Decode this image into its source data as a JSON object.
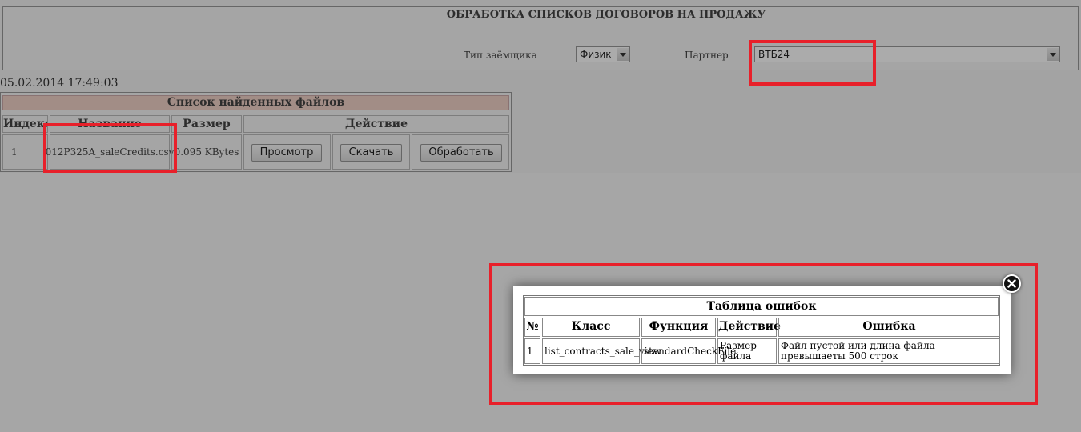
{
  "header": {
    "title": "ОБРАБОТКА СПИСКОВ ДОГОВОРОВ НА ПРОДАЖУ",
    "borrower_type_label": "Тип заёмщика",
    "borrower_type_value": "Физик",
    "partner_label": "Партнер",
    "partner_value": "ВТБ24"
  },
  "timestamp": "05.02.2014 17:49:03",
  "files": {
    "caption": "Список найденных файлов",
    "columns": [
      "Индекс",
      "Название",
      "Размер",
      "Действие"
    ],
    "rows": [
      {
        "index": "1",
        "name": "012P325A_saleCredits.csv",
        "size": "0.095 KBytes",
        "view_label": "Просмотр",
        "download_label": "Скачать",
        "process_label": "Обработать"
      }
    ]
  },
  "error_modal": {
    "title": "Таблица ошибок",
    "columns": [
      "№",
      "Класс",
      "Функция",
      "Действие",
      "Ошибка"
    ],
    "rows": [
      {
        "num": "1",
        "class": "list_contracts_sale_view",
        "function": "standardCheckFile",
        "action": "Размер файла",
        "error": "Файл пустой или длина файла превышаеты 500 строк"
      }
    ]
  },
  "colors": {
    "highlight": "#e8202a",
    "caption_bg": "#f2d2c8",
    "overlay": "#a6a6a6"
  }
}
